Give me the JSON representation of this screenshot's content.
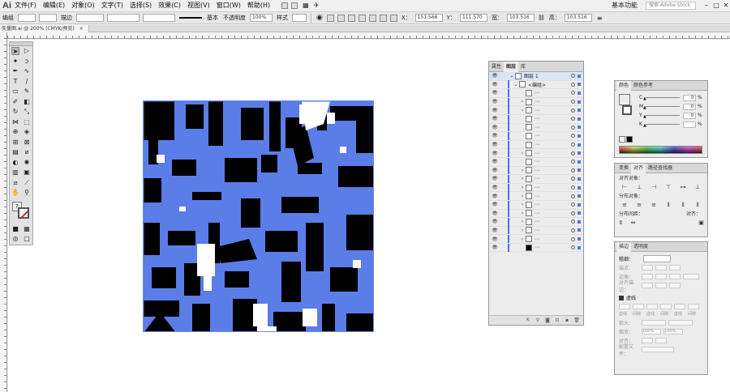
{
  "app": {
    "logo": "Ai"
  },
  "menu": [
    "文件(F)",
    "编辑(E)",
    "对象(O)",
    "文字(T)",
    "选择(S)",
    "效果(C)",
    "视图(V)",
    "窗口(W)",
    "帮助(H)"
  ],
  "topright": {
    "workspace": "基本功能",
    "search_placeholder": "搜索 Adobe Stock",
    "minimize": "–",
    "maximize": "□",
    "close": "✕"
  },
  "control": {
    "selection_label": "编组",
    "stroke_label": "描边",
    "brush_label": "基本",
    "opacity_label": "不透明度",
    "opacity_value": "100%",
    "style_label": "样式",
    "x_label": "X：",
    "x_value": "151.566",
    "y_label": "Y：",
    "y_value": "111.570",
    "w_label": "宽：",
    "w_value": "103.516",
    "h_label": "高：",
    "h_value": "103.516"
  },
  "document": {
    "tab_title": "矢量图.ai @ 200% (CMYK/预览)",
    "close": "✕"
  },
  "layers_panel": {
    "tabs": [
      "属性",
      "图层",
      "库"
    ],
    "layer_name": "图层 1",
    "group_name": "<编组>",
    "rows": [
      {
        "chev": "",
        "thumb": "white"
      },
      {
        "chev": "›",
        "thumb": "white"
      },
      {
        "chev": "›",
        "thumb": "white"
      },
      {
        "chev": "",
        "thumb": "line"
      },
      {
        "chev": "",
        "thumb": "white"
      },
      {
        "chev": "",
        "thumb": "bar"
      },
      {
        "chev": "",
        "thumb": "white"
      },
      {
        "chev": "›",
        "thumb": "white"
      },
      {
        "chev": "",
        "thumb": "white"
      },
      {
        "chev": "›",
        "thumb": "white"
      },
      {
        "chev": "›",
        "thumb": "white"
      },
      {
        "chev": "›",
        "thumb": "white"
      },
      {
        "chev": "›",
        "thumb": "white"
      },
      {
        "chev": "›",
        "thumb": "white"
      },
      {
        "chev": "›",
        "thumb": "white"
      },
      {
        "chev": "›",
        "thumb": "white"
      },
      {
        "chev": "›",
        "thumb": "white"
      },
      {
        "chev": "›",
        "thumb": "white"
      },
      {
        "chev": "",
        "thumb": "black"
      }
    ],
    "row_dots": "⋯"
  },
  "color_panel": {
    "tabs": [
      "颜色",
      "颜色参考"
    ],
    "channels": [
      {
        "label": "C",
        "value": "0"
      },
      {
        "label": "M",
        "value": "0"
      },
      {
        "label": "Y",
        "value": "0"
      },
      {
        "label": "K",
        "value": ""
      }
    ],
    "unit": "%"
  },
  "align_panel": {
    "tabs": [
      "变换",
      "对齐",
      "路径查找器"
    ],
    "align_objects": "对齐对象：",
    "distribute_objects": "分布对象：",
    "distribute_spacing": "分布间距：",
    "align_to": "对齐："
  },
  "stroke_panel": {
    "tabs": [
      "描边",
      "透明度"
    ],
    "weight_label": "粗细：",
    "cap_label": "端点：",
    "corner_label": "边角：",
    "align_stroke_label": "对齐描边：",
    "dashed_label": "虚线",
    "dash_labels": [
      "虚线",
      "间隙",
      "虚线",
      "间隙",
      "虚线",
      "间隙"
    ],
    "arrow_label": "箭头：",
    "scale_label": "缩放：",
    "scale_value_1": "100%",
    "scale_value_2": "100%",
    "align_label": "对齐：",
    "profile_label": "配置文件："
  },
  "colors": {
    "artwork_blue": "#5b7de8",
    "selection_blue": "#4a78e0",
    "stroke_red": "#e02020"
  }
}
